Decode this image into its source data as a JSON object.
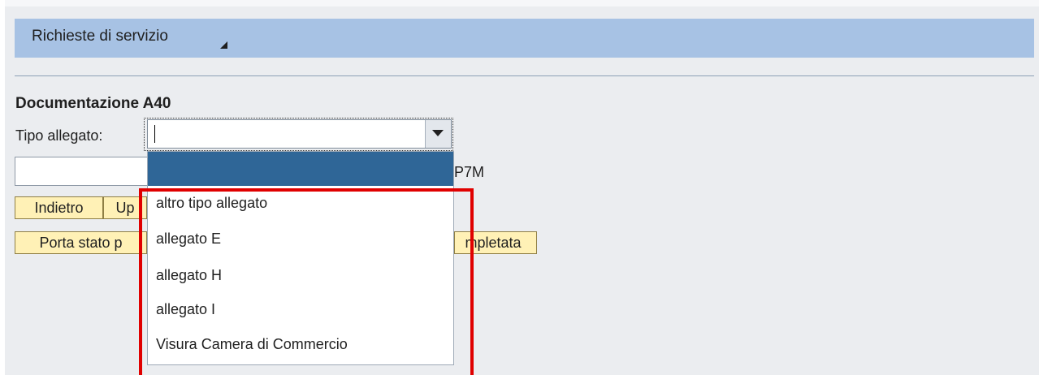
{
  "header": {
    "title": "Richieste di servizio"
  },
  "section": {
    "title": "Documentazione A40"
  },
  "attachment": {
    "label": "Tipo allegato:",
    "selected": "",
    "file_suffix_visible": "P7M"
  },
  "buttons": {
    "back_label": "Indietro",
    "upload_label_visible": "Up",
    "status_label_visible_left": "Porta stato p",
    "status_label_visible_right": "mpletata"
  },
  "dropdown": {
    "options": [
      "",
      "altro tipo allegato",
      "allegato E",
      "allegato H",
      "allegato I",
      "Visura Camera di Commercio"
    ]
  },
  "colors": {
    "header_background": "#a7c2e4",
    "button_background": "#fff1b6",
    "selected_option": "#2f6697",
    "annotation_outline": "#e00000"
  }
}
